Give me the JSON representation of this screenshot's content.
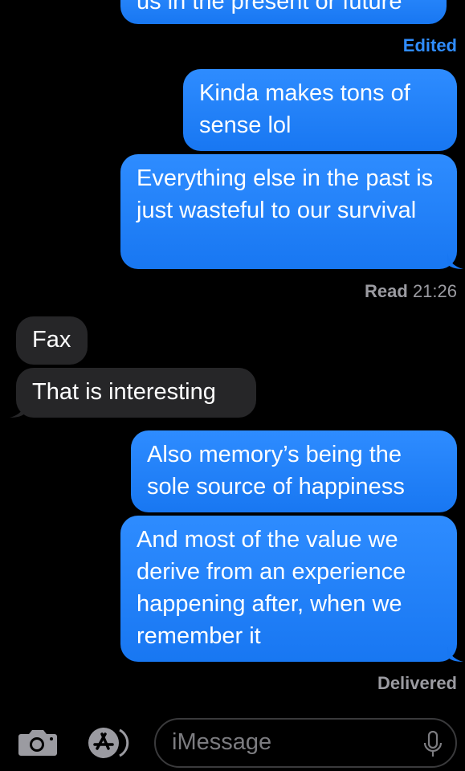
{
  "messages": [
    {
      "id": "m0",
      "dir": "out",
      "text": "us in the present or future"
    },
    {
      "id": "m1",
      "dir": "out",
      "text": "Kinda makes tons of sense lol"
    },
    {
      "id": "m2",
      "dir": "out",
      "text": "Everything else in the past is just wasteful to our survival"
    },
    {
      "id": "m3",
      "dir": "in",
      "text": "Fax"
    },
    {
      "id": "m4",
      "dir": "in",
      "text": "That is interesting"
    },
    {
      "id": "m5",
      "dir": "out",
      "text": "Also memory’s being the sole source of happiness"
    },
    {
      "id": "m6",
      "dir": "out",
      "text": "And most of the value we derive from an experience happening after, when we remember it"
    }
  ],
  "edited_label": "Edited",
  "read_status": {
    "label": "Read",
    "time": "21:26"
  },
  "delivered_label": "Delivered",
  "input": {
    "placeholder": "iMessage"
  },
  "icons": {
    "camera": "camera-icon",
    "apps": "app-store-icon",
    "mic": "microphone-icon"
  },
  "colors": {
    "outgoing_bubble": "#1f7fff",
    "incoming_bubble": "#262628",
    "status_text": "#9b9ba1",
    "edited_text": "#2f8cff",
    "background": "#000000"
  }
}
